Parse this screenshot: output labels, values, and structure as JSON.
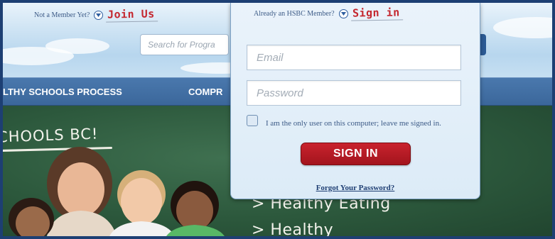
{
  "header": {
    "join": {
      "question": "Not a Member Yet?",
      "link": "Join Us"
    },
    "search": {
      "placeholder": "Search for Progra"
    }
  },
  "nav": {
    "items": [
      {
        "label": "LTHY SCHOOLS PROCESS"
      },
      {
        "label": "COMPR"
      }
    ]
  },
  "hero": {
    "title": "CHOOLS BC!",
    "list": [
      "> Healthy Eating",
      "> Healthy"
    ],
    "colon": ":"
  },
  "login": {
    "question": "Already an HSBC Member?",
    "link": "Sign in",
    "email_placeholder": "Email",
    "password_placeholder": "Password",
    "remember_text": "I am the only user on this computer; leave me signed in.",
    "button": "SIGN IN",
    "forgot": "Forgot Your Password?"
  },
  "colors": {
    "frame": "#1d3f73",
    "nav": "#3b679b",
    "accent_red": "#c4272f",
    "chalkboard": "#2c583c"
  },
  "icons": [
    "chevron-down-icon",
    "checkbox-icon"
  ]
}
